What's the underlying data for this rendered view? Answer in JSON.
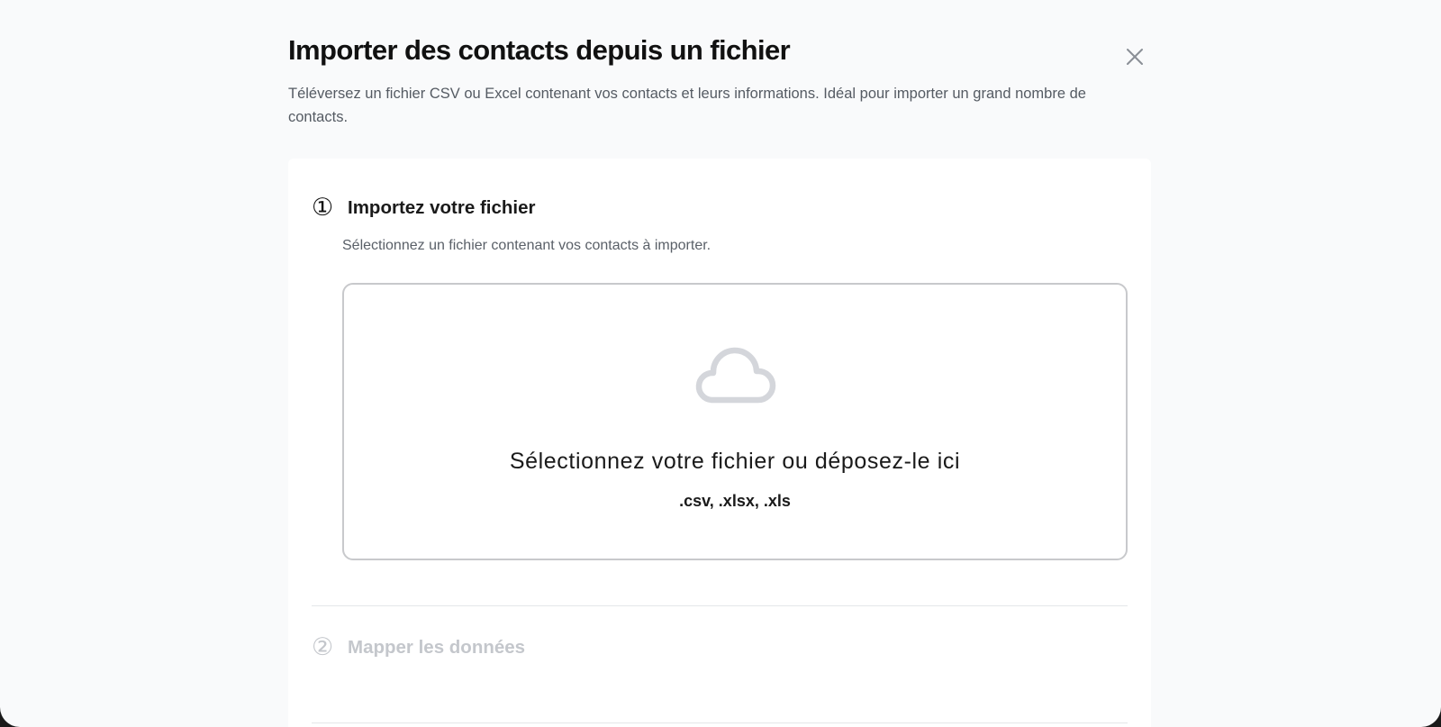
{
  "dialog": {
    "title": "Importer des contacts depuis un fichier",
    "subtitle": "Téléversez un fichier CSV ou Excel contenant vos contacts et leurs informations. Idéal pour importer un grand nombre de contacts.",
    "close_icon": "close-icon"
  },
  "steps": [
    {
      "number": "①",
      "title": "Importez votre fichier",
      "description": "Sélectionnez un fichier contenant vos contacts à importer.",
      "state": "active"
    },
    {
      "number": "②",
      "title": "Mapper les données",
      "state": "disabled"
    }
  ],
  "dropzone": {
    "icon": "cloud-icon",
    "text": "Sélectionnez votre fichier ou déposez-le ici",
    "formats": ".csv, .xlsx, .xls"
  },
  "colors": {
    "background": "#f9fafb",
    "card": "#ffffff",
    "text_primary": "#111111",
    "text_secondary": "#555b63",
    "disabled": "#c4c7cc",
    "cloud_icon": "#d4d6db",
    "dropzone_border": "#c8c9cc"
  }
}
